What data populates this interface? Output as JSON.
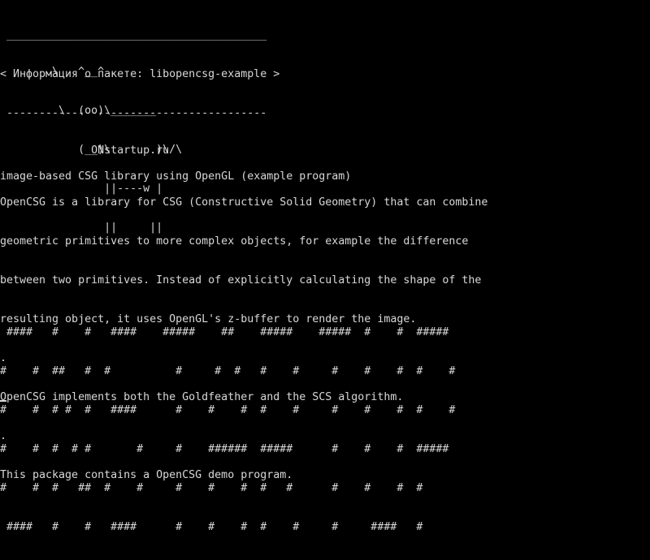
{
  "terminal": {
    "cowsay": {
      "border_top": " ________________________________________",
      "message": "< Информация о пакете: libopencsg-example >",
      "border_bottom": " ----------------------------------------",
      "cow": [
        "        \\   ^__^",
        "         \\  (oo)\\_______",
        "            (__)\\       )\\/\\",
        "                ||----w |",
        "                ||     ||"
      ]
    },
    "site": "              ONstartup.ru",
    "summary": "image-based CSG library using OpenGL (example program)",
    "description": [
      "OpenCSG is a library for CSG (Constructive Solid Geometry) that can combine",
      "geometric primitives to more complex objects, for example the difference",
      "between two primitives. Instead of explicitly calculating the shape of the",
      "resulting object, it uses OpenGL's z-buffer to render the image.",
      ".",
      "OpenCSG implements both the Goldfeather and the SCS algorithm.",
      ".",
      "This package contains a OpenCSG demo program."
    ],
    "banner": [
      " ####   #    #   ####    #####    ##    #####    #####  #    #  #####",
      "#    #  ##   #  #          #     #  #   #    #     #    #    #  #    #",
      "#    #  # #  #   ####      #    #    #  #    #     #    #    #  #    #",
      "#    #  #  # #       #     #    ######  #####      #    #    #  #####",
      "#    #  #   ##  #    #     #    #    #  #   #      #    #    #  #",
      " ####   #    #   ####      #    #    #  #    #     #     ####   #"
    ]
  }
}
